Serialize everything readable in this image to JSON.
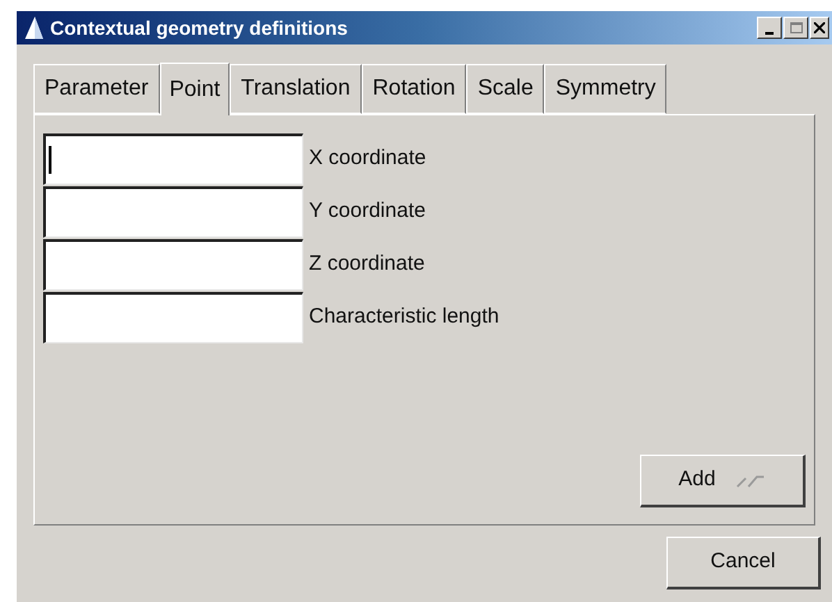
{
  "window": {
    "title": "Contextual geometry definitions"
  },
  "tabs": [
    {
      "label": "Parameter",
      "selected": false
    },
    {
      "label": "Point",
      "selected": true
    },
    {
      "label": "Translation",
      "selected": false
    },
    {
      "label": "Rotation",
      "selected": false
    },
    {
      "label": "Scale",
      "selected": false
    },
    {
      "label": "Symmetry",
      "selected": false
    }
  ],
  "fields": [
    {
      "label": "X coordinate",
      "focused": true
    },
    {
      "label": "Y coordinate",
      "focused": false
    },
    {
      "label": "Z coordinate",
      "focused": false
    },
    {
      "label": "Characteristic length",
      "focused": false
    }
  ],
  "add_button": "Add",
  "cancel_button": "Cancel"
}
